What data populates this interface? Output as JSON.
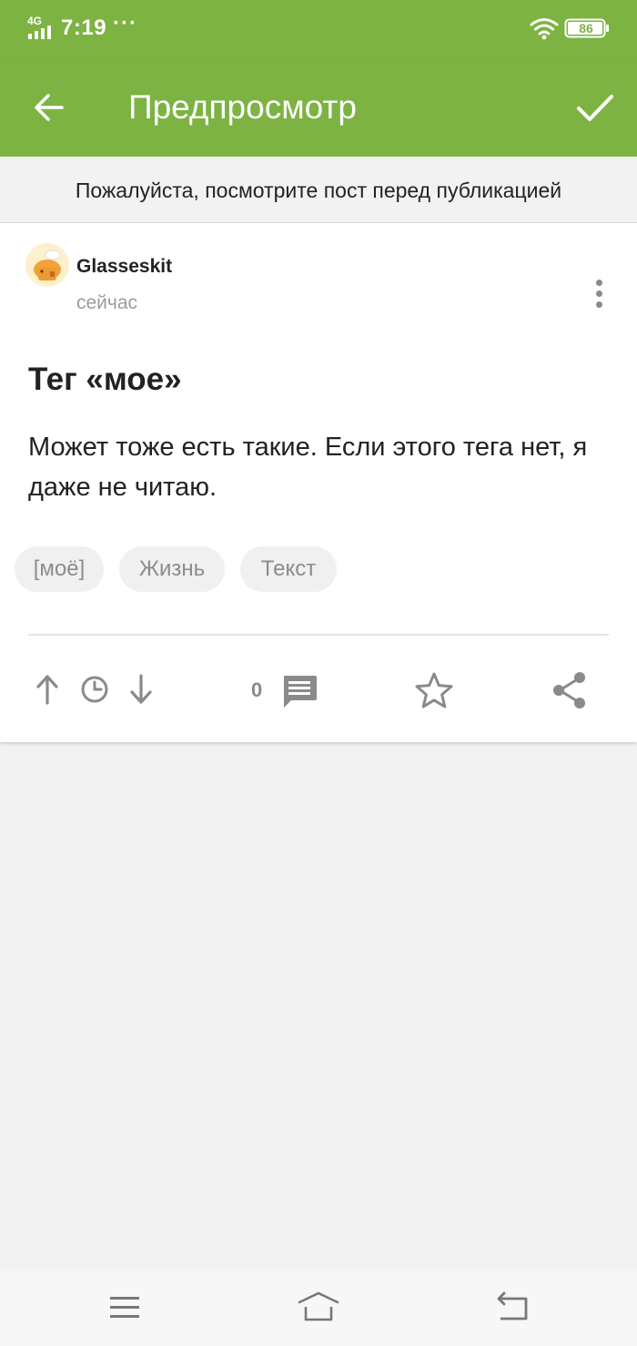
{
  "status_bar": {
    "network": "4G",
    "time": "7:19",
    "dots": "···",
    "battery": "86",
    "icons": [
      "signal-icon",
      "wifi-icon",
      "battery-icon"
    ]
  },
  "app_bar": {
    "title": "Предпросмотр",
    "back_icon": "arrow-left-icon",
    "confirm_icon": "check-icon",
    "color": "#7cb342"
  },
  "notice": {
    "text": "Пожалуйста, посмотрите пост перед публикацией"
  },
  "post": {
    "author": "Glasseskit",
    "time": "сейчас",
    "title": "Тег «мое»",
    "body": "Может тоже есть такие. Если этого тега нет, я даже не читаю.",
    "tags": [
      "[моё]",
      "Жизнь",
      "Текст"
    ],
    "comment_count": "0",
    "actions": [
      "arrow-up-icon",
      "clock-icon",
      "arrow-down-icon",
      "comment-icon",
      "star-icon",
      "share-icon"
    ]
  },
  "nav_bar": {
    "icons": [
      "menu-icon",
      "home-icon",
      "back-icon"
    ]
  }
}
